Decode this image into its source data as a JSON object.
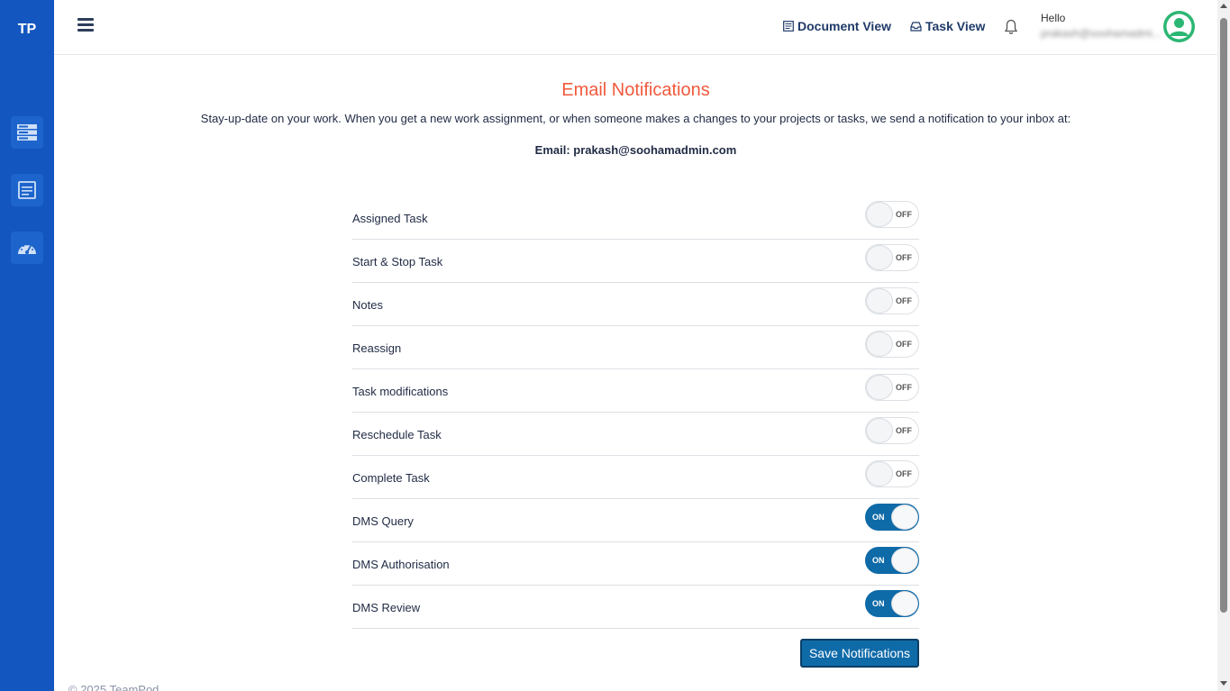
{
  "brand": {
    "logo": "TP",
    "color": "#1456c0"
  },
  "sidebar": {
    "items": [
      {
        "icon": "server-icon"
      },
      {
        "icon": "document-list-icon"
      },
      {
        "icon": "dashboard-gauge-icon"
      }
    ]
  },
  "header": {
    "menu_icon": "hamburger-icon",
    "document_view": "Document View",
    "task_view": "Task View",
    "greeting": "Hello",
    "user_email": "prakash@soohamadmi..."
  },
  "page": {
    "title": "Email Notifications",
    "title_color": "#f05a3c",
    "description": "Stay-up-date on your work. When you get a new work assignment, or when someone makes a changes to your projects or tasks, we send a notification to your inbox at:",
    "email_line": "Email: prakash@soohamadmin.com"
  },
  "notifications": [
    {
      "label": "Assigned Task",
      "state": "OFF"
    },
    {
      "label": "Start & Stop Task",
      "state": "OFF"
    },
    {
      "label": "Notes",
      "state": "OFF"
    },
    {
      "label": "Reassign",
      "state": "OFF"
    },
    {
      "label": "Task modifications",
      "state": "OFF"
    },
    {
      "label": "Reschedule Task",
      "state": "OFF"
    },
    {
      "label": "Complete Task",
      "state": "OFF"
    },
    {
      "label": "DMS Query",
      "state": "ON"
    },
    {
      "label": "DMS Authorisation",
      "state": "ON"
    },
    {
      "label": "DMS Review",
      "state": "ON"
    }
  ],
  "actions": {
    "save_label": "Save Notifications",
    "accent": "#0f6aa8"
  },
  "footer": {
    "text": "© 2025 TeamPod"
  }
}
